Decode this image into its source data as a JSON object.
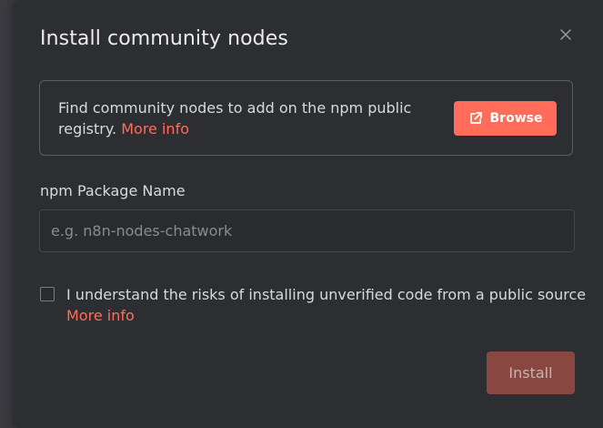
{
  "dialog": {
    "title": "Install community nodes",
    "close_icon": "close-icon"
  },
  "info": {
    "text": "Find community nodes to add on the npm public registry.",
    "more_info_label": "More info",
    "browse_label": "Browse",
    "browse_icon": "external-link-icon"
  },
  "package_field": {
    "label": "npm Package Name",
    "placeholder": "e.g. n8n-nodes-chatwork",
    "value": ""
  },
  "consent": {
    "checked": false,
    "text": "I understand the risks of installing unverified code from a public source",
    "more_info_label": "More info"
  },
  "actions": {
    "install_label": "Install"
  },
  "colors": {
    "accent": "#ff6d5a",
    "dialog_bg": "#2d2e31",
    "install_disabled": "#8a4741"
  }
}
